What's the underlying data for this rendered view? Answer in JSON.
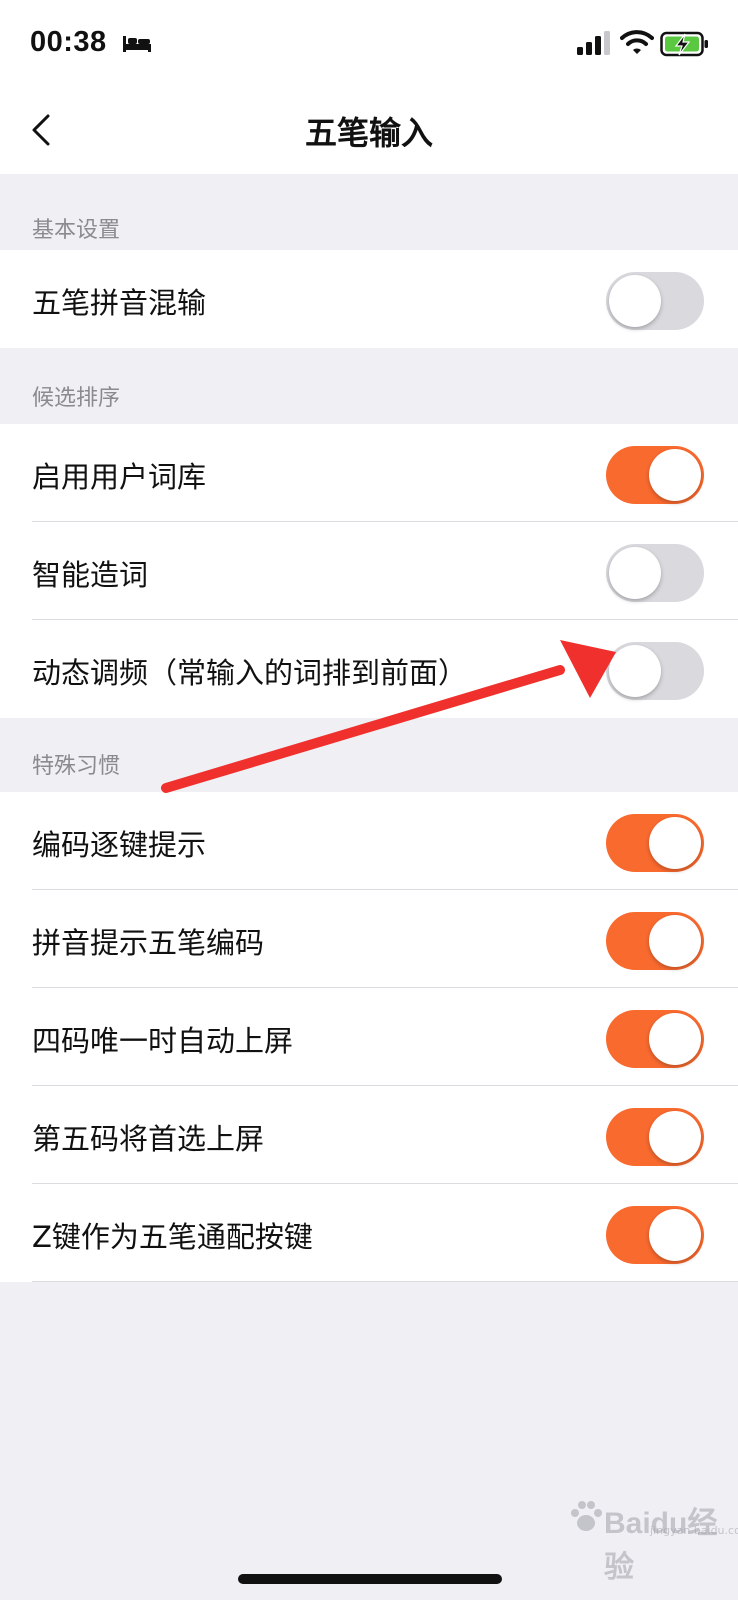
{
  "status_bar": {
    "time": "00:38",
    "icons": [
      "bed-icon",
      "signal-icon",
      "wifi-icon",
      "battery-charging-icon"
    ]
  },
  "nav": {
    "title": "五笔输入",
    "back_icon": "chevron-left-icon"
  },
  "sections": [
    {
      "header": "基本设置",
      "items": [
        {
          "label": "五笔拼音混输",
          "on": false
        }
      ]
    },
    {
      "header": "候选排序",
      "items": [
        {
          "label": "启用用户词库",
          "on": true
        },
        {
          "label": "智能造词",
          "on": false
        },
        {
          "label": "动态调频（常输入的词排到前面）",
          "on": false
        }
      ]
    },
    {
      "header": "特殊习惯",
      "items": [
        {
          "label": "编码逐键提示",
          "on": true
        },
        {
          "label": "拼音提示五笔编码",
          "on": true
        },
        {
          "label": "四码唯一时自动上屏",
          "on": true
        },
        {
          "label": "第五码将首选上屏",
          "on": true
        },
        {
          "label": "Z键作为五笔通配按键",
          "on": true
        }
      ]
    }
  ],
  "watermark": {
    "brand": "Baidu经验",
    "sub": "jingyan.baidu.com"
  },
  "colors": {
    "toggle_on": "#f96a2f",
    "toggle_off": "#d9d9de",
    "annotation_arrow": "#f0302c",
    "background": "#efeff4"
  }
}
